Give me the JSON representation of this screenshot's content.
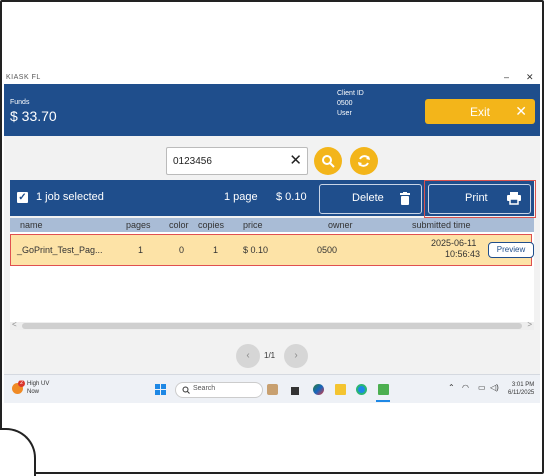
{
  "window": {
    "title": "KIASK FL",
    "minimize_label": "–",
    "close_label": "✕"
  },
  "header": {
    "funds_label": "Funds",
    "funds_value": "$ 33.70",
    "client_id_label": "Client ID",
    "client_id_value": "0500",
    "user_label": "User",
    "exit_label": "Exit"
  },
  "search": {
    "value": "0123456",
    "clear_icon": "close-icon",
    "search_icon": "search-icon",
    "refresh_icon": "refresh-icon"
  },
  "toolbar": {
    "selected_label": "1 job selected",
    "pages_label": "1 page",
    "price_label": "$ 0.10",
    "delete_label": "Delete",
    "print_label": "Print"
  },
  "table": {
    "columns": [
      "name",
      "pages",
      "color",
      "copies",
      "price",
      "owner",
      "submitted time"
    ],
    "rows": [
      {
        "name": "_GoPrint_Test_Pag...",
        "pages": "1",
        "color": "0",
        "copies": "1",
        "price": "$ 0.10",
        "owner": "0500",
        "submitted_date": "2025-06-11",
        "submitted_time": "10:56:43",
        "preview_label": "Preview"
      }
    ]
  },
  "pager": {
    "label": "1/1",
    "prev_icon": "chevron-left-icon",
    "next_icon": "chevron-right-icon"
  },
  "taskbar": {
    "weather_line1": "High UV",
    "weather_line2": "Now",
    "weather_badge": "2",
    "search_placeholder": "Search",
    "clock_time": "3:01 PM",
    "clock_date": "6/11/2025"
  },
  "colors": {
    "header_bg": "#1f4e8c",
    "accent": "#f3b51a",
    "selected_row": "#fde3a7",
    "highlight_border": "#e05050"
  }
}
